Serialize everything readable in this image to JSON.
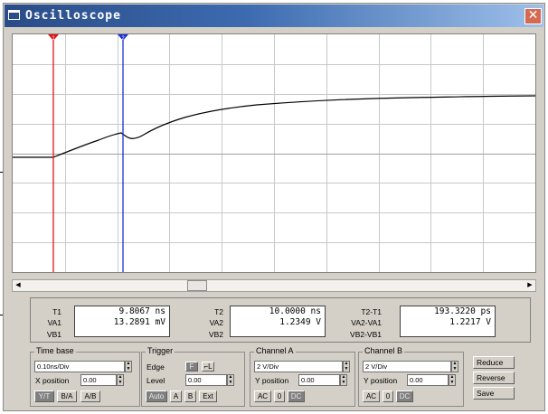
{
  "window": {
    "title": "Oscilloscope",
    "close_glyph": "✕"
  },
  "screen": {
    "cursor1_label": "1",
    "cursor2_label": "2",
    "colors": {
      "cursor1": "#e0141a",
      "cursor2": "#1a2fd6",
      "trace": "#000000",
      "grid": "#c8c8c8"
    }
  },
  "scrollbar": {
    "left_arrow": "◀",
    "right_arrow": "▶"
  },
  "readout": {
    "t1": {
      "label": "T1",
      "value": "9.8067 ns"
    },
    "va1": {
      "label": "VA1",
      "value": "13.2891 mV"
    },
    "vb1": {
      "label": "VB1",
      "value": ""
    },
    "t2": {
      "label": "T2",
      "value": "10.0000 ns"
    },
    "va2": {
      "label": "VA2",
      "value": "1.2349  V"
    },
    "vb2": {
      "label": "VB2",
      "value": ""
    },
    "dt": {
      "label": "T2-T1",
      "value": "193.3220 ps"
    },
    "dva": {
      "label": "VA2-VA1",
      "value": "1.2217  V"
    },
    "dvb": {
      "label": "VB2-VB1",
      "value": ""
    }
  },
  "timebase": {
    "title": "Time base",
    "scale": "0.10ns/Div",
    "xpos_label": "X position",
    "xpos": "0.00",
    "modes": [
      "Y/T",
      "B/A",
      "A/B"
    ]
  },
  "trigger": {
    "title": "Trigger",
    "edge_label": "Edge",
    "edge_rise": "F",
    "edge_fall": "⌐L",
    "level_label": "Level",
    "level": "0.00",
    "sources": [
      "Auto",
      "A",
      "B",
      "Ext"
    ]
  },
  "channel_a": {
    "title": "Channel A",
    "scale": "2 V/Div",
    "ypos_label": "Y position",
    "ypos": "0.00",
    "coupling": [
      "AC",
      "0",
      "DC"
    ]
  },
  "channel_b": {
    "title": "Channel B",
    "scale": "2 V/Div",
    "ypos_label": "Y position",
    "ypos": "0.00",
    "coupling": [
      "AC",
      "0",
      "DC"
    ]
  },
  "actions": {
    "reduce": "Reduce",
    "reverse": "Reverse",
    "save": "Save"
  },
  "icons": {
    "window": "window-icon",
    "close": "close-icon",
    "spin": "spin-arrows-icon"
  }
}
